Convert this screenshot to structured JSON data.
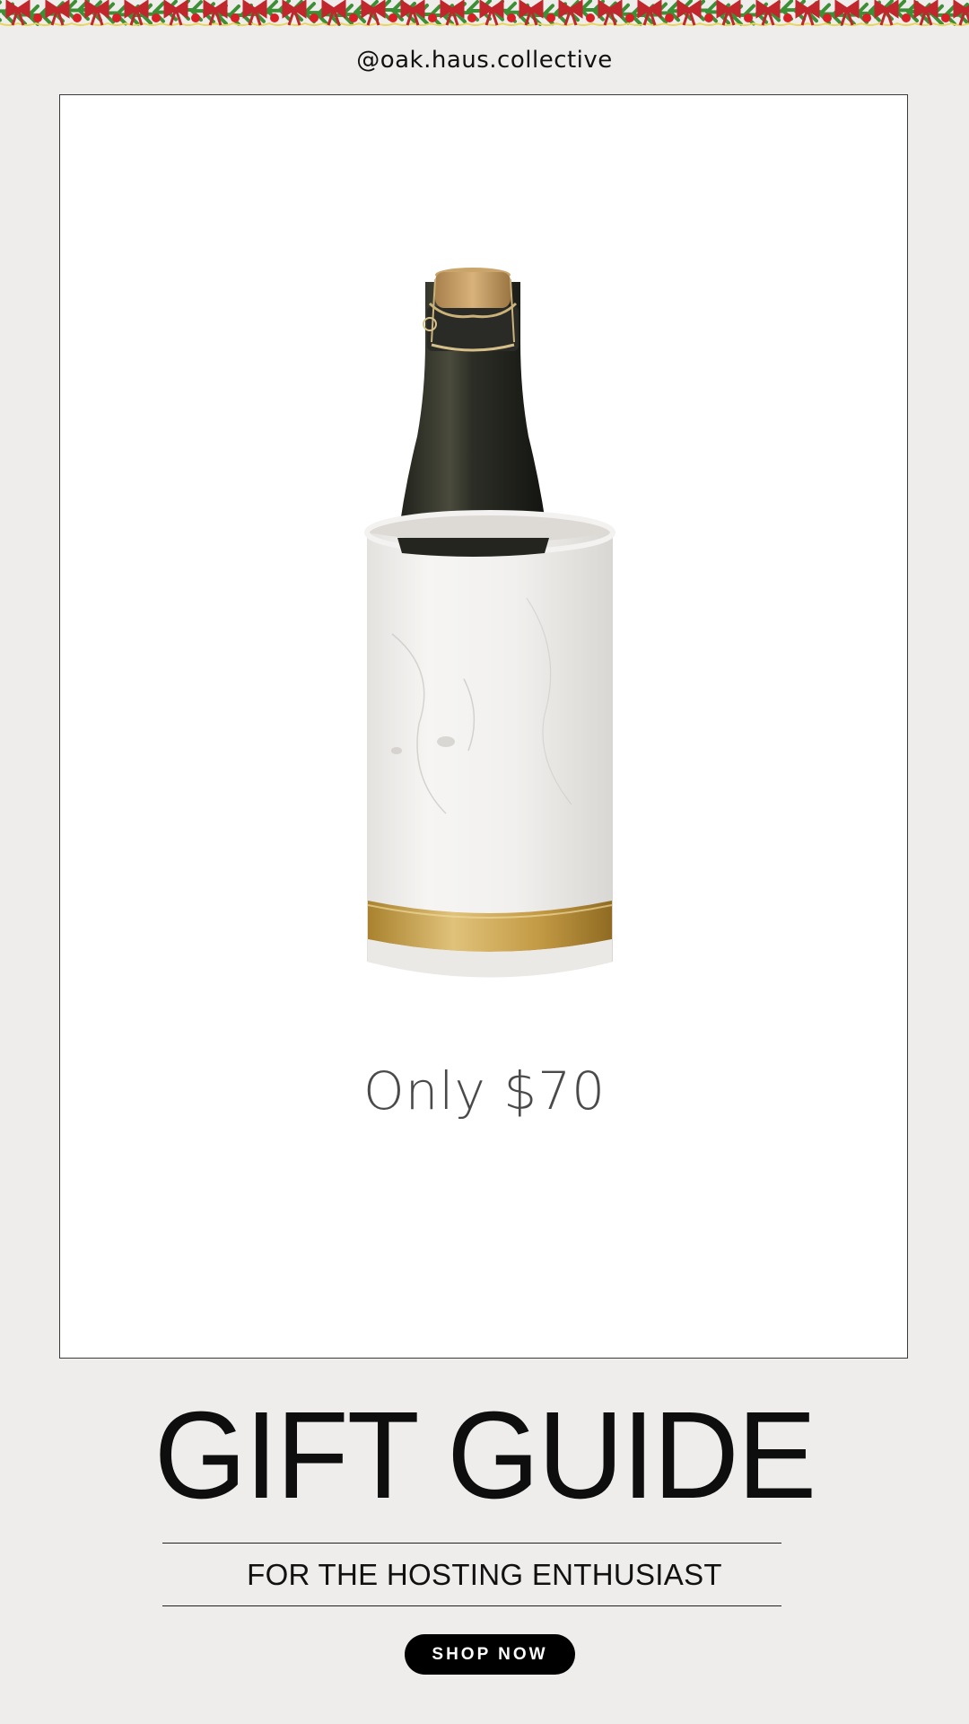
{
  "handle": "@oak.haus.collective",
  "product": {
    "name_icon": "champagne-bottle-in-marble-chiller",
    "price_text": "Only $70"
  },
  "title": "GIFT GUIDE",
  "subtitle": "FOR THE HOSTING ENTHUSIAST",
  "cta": {
    "label": "SHOP NOW"
  },
  "colors": {
    "background": "#eeedeb",
    "card": "#ffffff",
    "button": "#000000",
    "garland_green": "#2f7a2a",
    "bow_red": "#c0262b",
    "ornament_red": "#d81f26",
    "gold": "#c9a24a"
  }
}
